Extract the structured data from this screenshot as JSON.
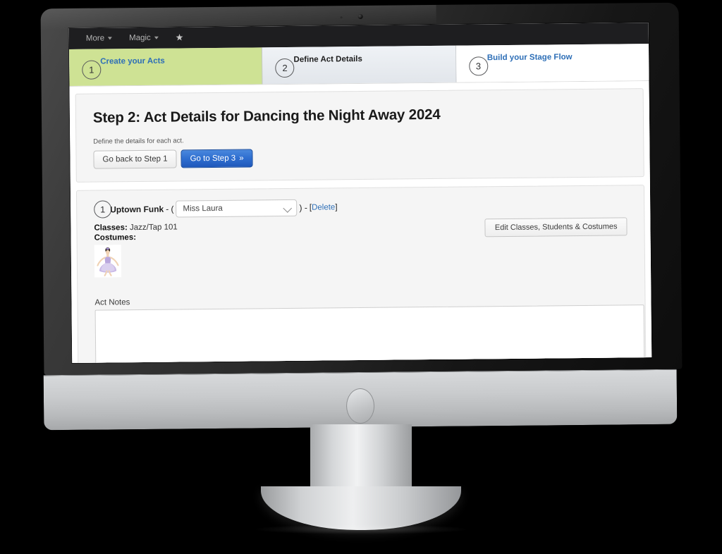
{
  "navbar": {
    "items": [
      {
        "label": "More",
        "icon": "chevron-down-icon"
      },
      {
        "label": "Magic",
        "icon": "chevron-down-icon"
      }
    ],
    "star_icon": "★"
  },
  "wizard": {
    "steps": [
      {
        "number": "1",
        "label": "Create your Acts",
        "state": "complete",
        "color": "#cee294"
      },
      {
        "number": "2",
        "label": "Define Act Details",
        "state": "current",
        "color": "#e6eaef"
      },
      {
        "number": "3",
        "label": "Build your Stage Flow",
        "state": "upcoming",
        "color": "#ffffff"
      }
    ]
  },
  "header": {
    "title": "Step 2: Act Details for Dancing the Night Away 2024",
    "subtitle": "Define the details for each act.",
    "back_button": "Go back to Step 1",
    "next_button": "Go to Step 3",
    "next_button_icon": "»"
  },
  "acts": [
    {
      "number": "1",
      "name": "Uptown Funk",
      "open_paren": "- (",
      "close_paren": ") -",
      "teacher_selected": "Miss Laura",
      "teacher_options": [
        "Miss Laura"
      ],
      "delete_label": "Delete",
      "bracket_open": "[",
      "bracket_close": "]",
      "classes_label": "Classes:",
      "classes_value": "Jazz/Tap 101",
      "costumes_label": "Costumes:",
      "costume_alt": "ballerina-costume-thumbnail",
      "edit_button": "Edit Classes, Students & Costumes",
      "notes_label": "Act Notes",
      "notes_value": "",
      "notes_placeholder": ""
    }
  ],
  "theme": {
    "accent_link": "#2e6fb7",
    "primary_button": "#2f6fd0",
    "step_complete": "#cee294",
    "navbar_bg": "#1e1e20"
  }
}
